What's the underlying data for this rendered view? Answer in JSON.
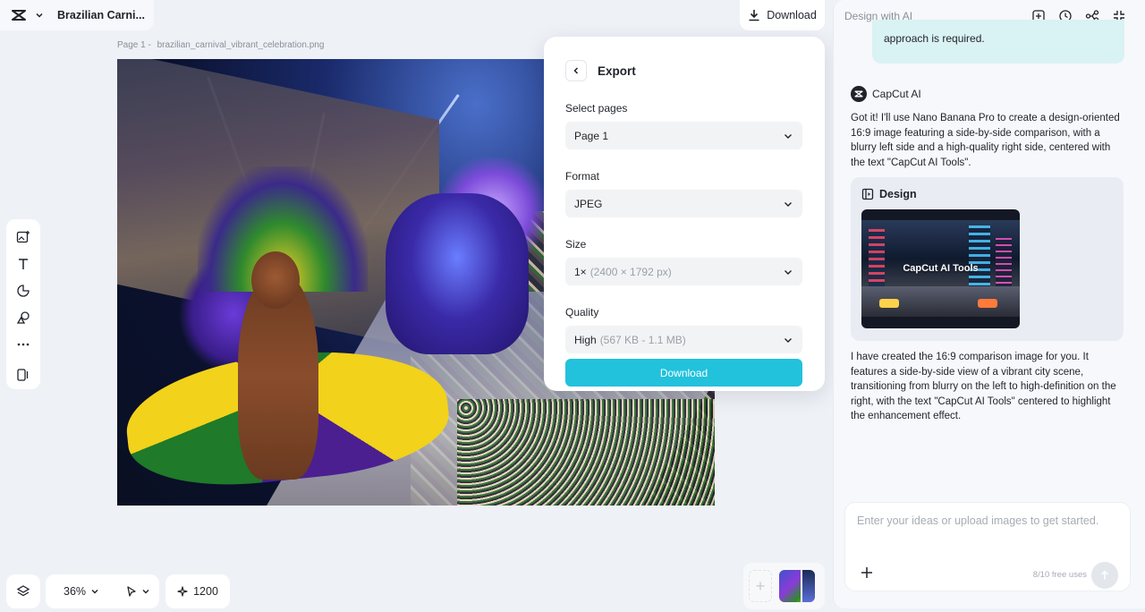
{
  "header": {
    "doc_title": "Brazilian Carni...",
    "download_label": "Download"
  },
  "canvas": {
    "page_label": "Page 1 -",
    "file_name": "brazilian_carnival_vibrant_celebration.png"
  },
  "export": {
    "title": "Export",
    "select_pages_label": "Select pages",
    "select_pages_value": "Page 1",
    "format_label": "Format",
    "format_value": "JPEG",
    "size_label": "Size",
    "size_value": "1×",
    "size_detail": "(2400 × 1792 px)",
    "quality_label": "Quality",
    "quality_value": "High",
    "quality_detail": "(567 KB - 1.1 MB)",
    "download_label": "Download"
  },
  "toolbar": {
    "zoom": "36%",
    "credits": "1200"
  },
  "panel": {
    "title": "Design with AI",
    "user_message_visible": "approach is required.",
    "ai_name": "CapCut AI",
    "ai_message_1": "Got it! I'll use Nano Banana Pro to create a design-oriented 16:9 image featuring a side-by-side comparison, with a blurry left side and a high-quality right side, centered with the text \"CapCut AI Tools\".",
    "design_label": "Design",
    "design_image_text": "CapCut AI Tools",
    "ai_message_2": "I have created the 16:9 comparison image for you. It features a side-by-side view of a vibrant city scene, transitioning from blurry on the left to high-definition on the right, with the text \"CapCut AI Tools\" centered to highlight the enhancement effect.",
    "composer_placeholder": "Enter your ideas or upload images to get started.",
    "free_uses": "8/10 free uses"
  },
  "colors": {
    "accent": "#22c1dc",
    "user_bubble": "#d9f2f3",
    "background": "#eef1f6"
  }
}
